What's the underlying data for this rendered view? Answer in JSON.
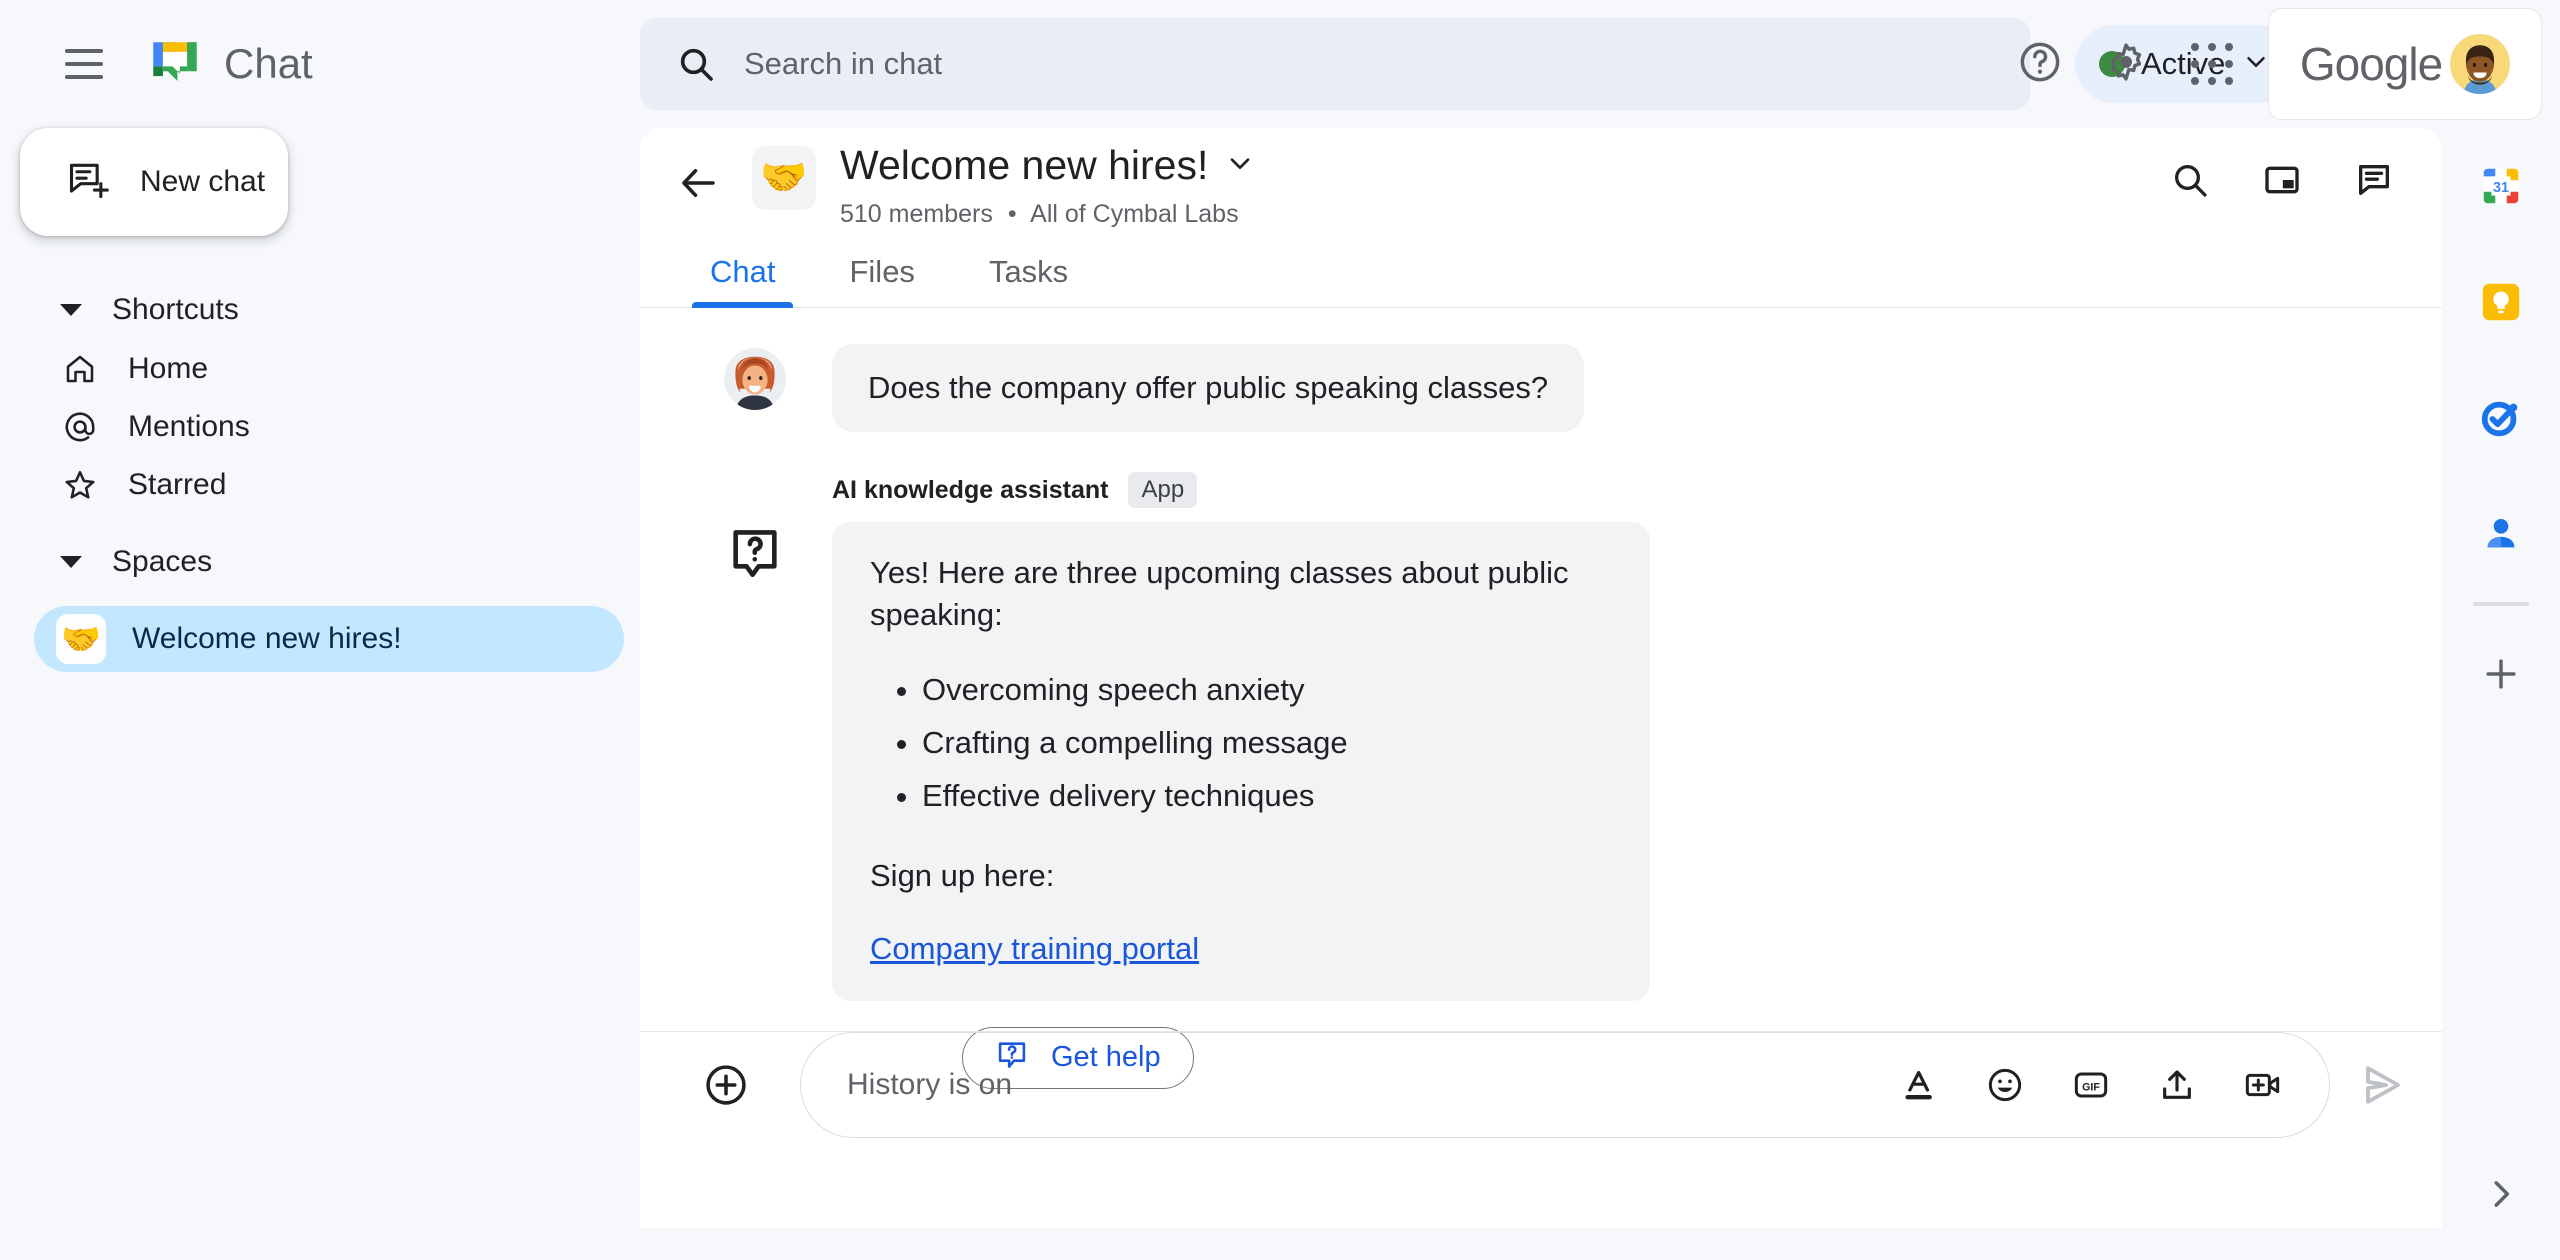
{
  "header": {
    "menu_icon": "hamburger-menu-icon",
    "brand_icon": "google-chat-logo",
    "brand_name": "Chat",
    "search": {
      "icon": "search-icon",
      "placeholder": "Search in chat",
      "value": ""
    },
    "presence": {
      "label": "Active",
      "dot_color": "#3c8c40",
      "chevron": "chevron-down-icon"
    },
    "help_icon": "help-circle-icon",
    "settings_icon": "gear-icon",
    "apps_icon": "apps-grid-icon",
    "account": {
      "logo_text": "Google",
      "avatar": "user-avatar"
    }
  },
  "sidebar": {
    "new_chat": {
      "label": "New chat",
      "icon": "new-chat-icon"
    },
    "shortcuts": {
      "title": "Shortcuts",
      "items": [
        {
          "label": "Home",
          "icon": "home-icon"
        },
        {
          "label": "Mentions",
          "icon": "at-sign-icon"
        },
        {
          "label": "Starred",
          "icon": "star-icon"
        }
      ]
    },
    "spaces": {
      "title": "Spaces",
      "items": [
        {
          "label": "Welcome new hires!",
          "emoji": "🤝",
          "selected": true
        }
      ]
    }
  },
  "chat": {
    "back_icon": "arrow-left-icon",
    "space_emoji": "🤝",
    "title": "Welcome new hires!",
    "title_chevron": "chevron-down-icon",
    "members": "510 members",
    "separator": "•",
    "audience": "All of Cymbal Labs",
    "actions": [
      {
        "icon": "search-icon",
        "name": "search-in-space-button"
      },
      {
        "icon": "picture-in-picture-icon",
        "name": "picture-in-picture-button"
      },
      {
        "icon": "threads-icon",
        "name": "threads-panel-button"
      }
    ],
    "tabs": [
      {
        "label": "Chat",
        "active": true
      },
      {
        "label": "Files",
        "active": false
      },
      {
        "label": "Tasks",
        "active": false
      }
    ],
    "messages": [
      {
        "type": "user",
        "avatar": "woman-avatar",
        "text": "Does the company offer public speaking classes?"
      },
      {
        "type": "bot",
        "sender": "AI knowledge assistant",
        "badge": "App",
        "icon": "question-bubble-icon",
        "intro": "Yes! Here are three upcoming classes about public speaking:",
        "bullets": [
          "Overcoming speech anxiety",
          "Crafting a compelling message",
          "Effective delivery techniques"
        ],
        "outro": "Sign up here:",
        "link_text": "Company training portal",
        "action_button": {
          "label": "Get help",
          "icon": "help-bubble-icon"
        }
      }
    ],
    "composer": {
      "add_icon": "plus-circle-icon",
      "placeholder": "History is on",
      "value": "",
      "tools": [
        {
          "icon": "format-text-icon",
          "name": "format-button"
        },
        {
          "icon": "emoji-icon",
          "name": "emoji-button"
        },
        {
          "icon": "gif-icon",
          "name": "gif-button",
          "label": "GIF"
        },
        {
          "icon": "upload-icon",
          "name": "upload-file-button"
        },
        {
          "icon": "add-video-icon",
          "name": "add-video-meeting-button"
        }
      ],
      "send_icon": "send-icon"
    }
  },
  "right_rail": {
    "items": [
      {
        "name": "google-calendar-icon",
        "label": "31"
      },
      {
        "name": "google-keep-icon",
        "label": ""
      },
      {
        "name": "google-tasks-icon",
        "label": ""
      },
      {
        "name": "google-contacts-icon",
        "label": ""
      }
    ],
    "add_icon": "plus-icon",
    "expand_icon": "chevron-right-icon"
  },
  "colors": {
    "accent_blue": "#1a73e8",
    "link_blue": "#1a56db",
    "page_bg": "#f6f8fc",
    "bubble_gray": "#f1f3f4",
    "selected_space": "#c2e7ff",
    "presence_green": "#3c8c40"
  }
}
